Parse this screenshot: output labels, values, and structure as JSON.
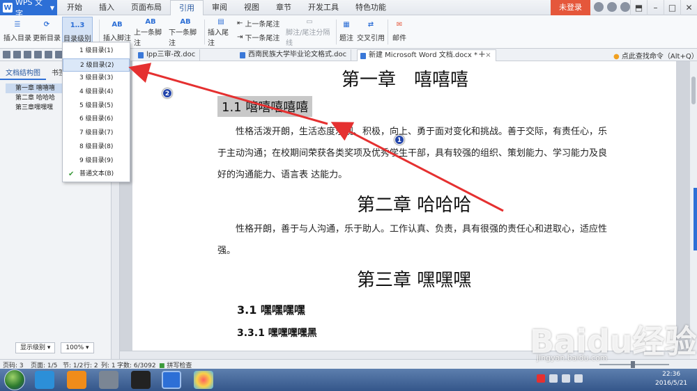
{
  "app": {
    "logo_text": "WPS 文字",
    "menu_tabs": [
      "开始",
      "插入",
      "页面布局",
      "引用",
      "审阅",
      "视图",
      "章节",
      "开发工具",
      "特色功能"
    ],
    "active_tab": "引用",
    "login_label": "未登录"
  },
  "ribbon": {
    "insert_toc": "插入目录",
    "update_toc": "更新目录",
    "toc_level": "目录级别",
    "insert_footnote": "插入脚注",
    "prev_footnote": "上一条脚注",
    "next_footnote": "下一条脚注",
    "insert_endnote": "插入尾注",
    "prev_endnote": "上一条尾注",
    "next_endnote": "下一条尾注",
    "footnote_separator": "脚注/尾注分隔线",
    "caption": "题注",
    "cross_ref": "交叉引用",
    "mail": "邮件",
    "ab_text": "AB"
  },
  "doc_tabs": {
    "tab1": "lpp三审-改.doc",
    "tab2": "西南民族大学毕业论文格式.doc",
    "tab3": "新建 Microsoft Word 文档.docx *",
    "close": "×",
    "plus": "+",
    "find_command": "点此查找命令（Alt+Q）"
  },
  "nav": {
    "tab_structure": "文档结构图",
    "tab_bookmark": "书签",
    "items": [
      "第一章 嘻嘻嘻",
      "第二章 哈哈哈",
      "第三章嘿嘿嘿"
    ],
    "show_level": "显示级别",
    "zoom": "100%"
  },
  "dropdown": {
    "items": [
      "1 级目录(1)",
      "2 级目录(2)",
      "3 级目录(3)",
      "4 级目录(4)",
      "5 级目录(5)",
      "6 级目录(6)",
      "7 级目录(7)",
      "8 级目录(8)",
      "9 级目录(9)",
      "普通文本(B)"
    ],
    "highlighted": "2 级目录(2)",
    "checked": "普通文本(B)"
  },
  "document": {
    "ch1": "第一章　嘻嘻嘻",
    "sec1_1": "1.1  嘻嘻嘻嘻嘻",
    "para1": "性格活泼开朗，生活态度乐观、积极，向上、勇于面对变化和挑战。善于交际，有责任心，乐于主动沟通；在校期间荣获各类奖项及优秀学生干部，具有较强的组织、策划能力、学习能力及良好的沟通能力、语言表  达能力。",
    "ch2": "第二章  哈哈哈",
    "para2": "性格开朗，善于与人沟通，乐于助人。工作认真、负责，具有很强的责任心和进取心，适应性强。",
    "ch3": "第三章  嘿嘿嘿",
    "sec3_1": "3.1  嘿嘿嘿嘿",
    "sec3_1_1": "3.3.1  嘿嘿嘿嘿黑"
  },
  "status": {
    "page_code": "页码: 3",
    "pages": "页面: 1/5",
    "section": "节: 1/2",
    "row": "行: 2",
    "col": "列: 1",
    "words": "字数: 6/3092",
    "spell": "拼写检查"
  },
  "taskbar": {
    "time": "22:36",
    "date": "2016/5/21"
  },
  "annotations": {
    "badge1": "1",
    "badge2": "2",
    "watermark": "Baidu经验",
    "watermark_url": "jingyan.baidu.com"
  },
  "colors": {
    "accent": "#2d6fd6",
    "login": "#e5573b",
    "arrow": "#e53030",
    "highlight": "#c8c8c8"
  }
}
